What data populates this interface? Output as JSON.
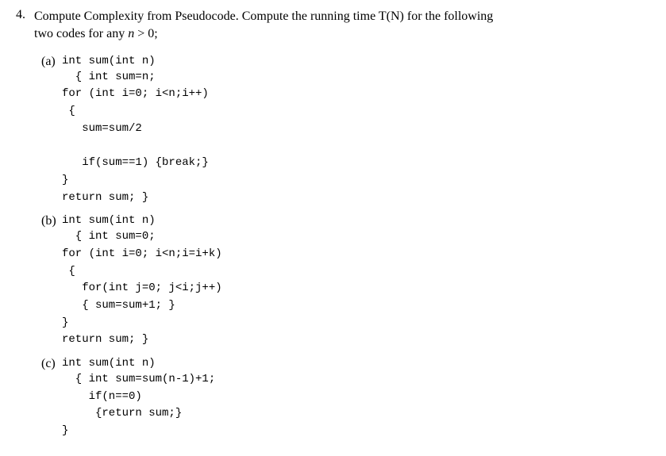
{
  "problem": {
    "number": "4.",
    "title_part1": "Compute Complexity from Pseudocode. Compute the running time T(N) for the following",
    "title_part2": "two codes for any ",
    "math_var": "n",
    "math_gt": " > 0;"
  },
  "subparts": [
    {
      "label": "(a)",
      "first_line": "int sum(int n)",
      "code": "  { int sum=n;\nfor (int i=0; i<n;i++)\n {\n   sum=sum/2\n\n   if(sum==1) {break;}\n}\nreturn sum; }"
    },
    {
      "label": "(b)",
      "first_line": "int sum(int n)",
      "code": "  { int sum=0;\nfor (int i=0; i<n;i=i+k)\n {\n   for(int j=0; j<i;j++)\n   { sum=sum+1; }\n}\nreturn sum; }"
    },
    {
      "label": "(c)",
      "first_line": "int sum(int n)",
      "code": "  { int sum=sum(n-1)+1;\n    if(n==0)\n     {return sum;}\n}"
    }
  ]
}
